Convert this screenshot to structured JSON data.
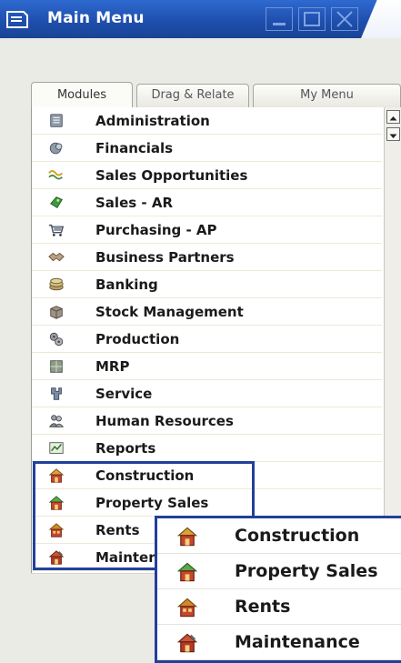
{
  "window": {
    "title": "Main Menu",
    "colors": {
      "titlebar": "#1f4fae",
      "highlight_border": "#21409a"
    }
  },
  "tabs": [
    {
      "label": "Modules",
      "active": true
    },
    {
      "label": "Drag & Relate",
      "active": false
    },
    {
      "label": "My Menu",
      "active": false
    }
  ],
  "modules": [
    {
      "label": "Administration",
      "icon": "administration-icon"
    },
    {
      "label": "Financials",
      "icon": "financials-icon"
    },
    {
      "label": "Sales Opportunities",
      "icon": "sales-opportunities-icon"
    },
    {
      "label": "Sales - AR",
      "icon": "sales-ar-icon"
    },
    {
      "label": "Purchasing - AP",
      "icon": "purchasing-ap-icon"
    },
    {
      "label": "Business Partners",
      "icon": "business-partners-icon"
    },
    {
      "label": "Banking",
      "icon": "banking-icon"
    },
    {
      "label": "Stock Management",
      "icon": "stock-management-icon"
    },
    {
      "label": "Production",
      "icon": "production-icon"
    },
    {
      "label": "MRP",
      "icon": "mrp-icon"
    },
    {
      "label": "Service",
      "icon": "service-icon"
    },
    {
      "label": "Human Resources",
      "icon": "human-resources-icon"
    },
    {
      "label": "Reports",
      "icon": "reports-icon"
    },
    {
      "label": "Construction",
      "icon": "construction-icon"
    },
    {
      "label": "Property Sales",
      "icon": "property-sales-icon"
    },
    {
      "label": "Rents",
      "icon": "rents-icon"
    },
    {
      "label": "Maintenance",
      "icon": "maintenance-icon"
    }
  ],
  "zoom": {
    "items": [
      {
        "label": "Construction",
        "icon": "construction-icon"
      },
      {
        "label": "Property Sales",
        "icon": "property-sales-icon"
      },
      {
        "label": "Rents",
        "icon": "rents-icon"
      },
      {
        "label": "Maintenance",
        "icon": "maintenance-icon"
      }
    ]
  }
}
